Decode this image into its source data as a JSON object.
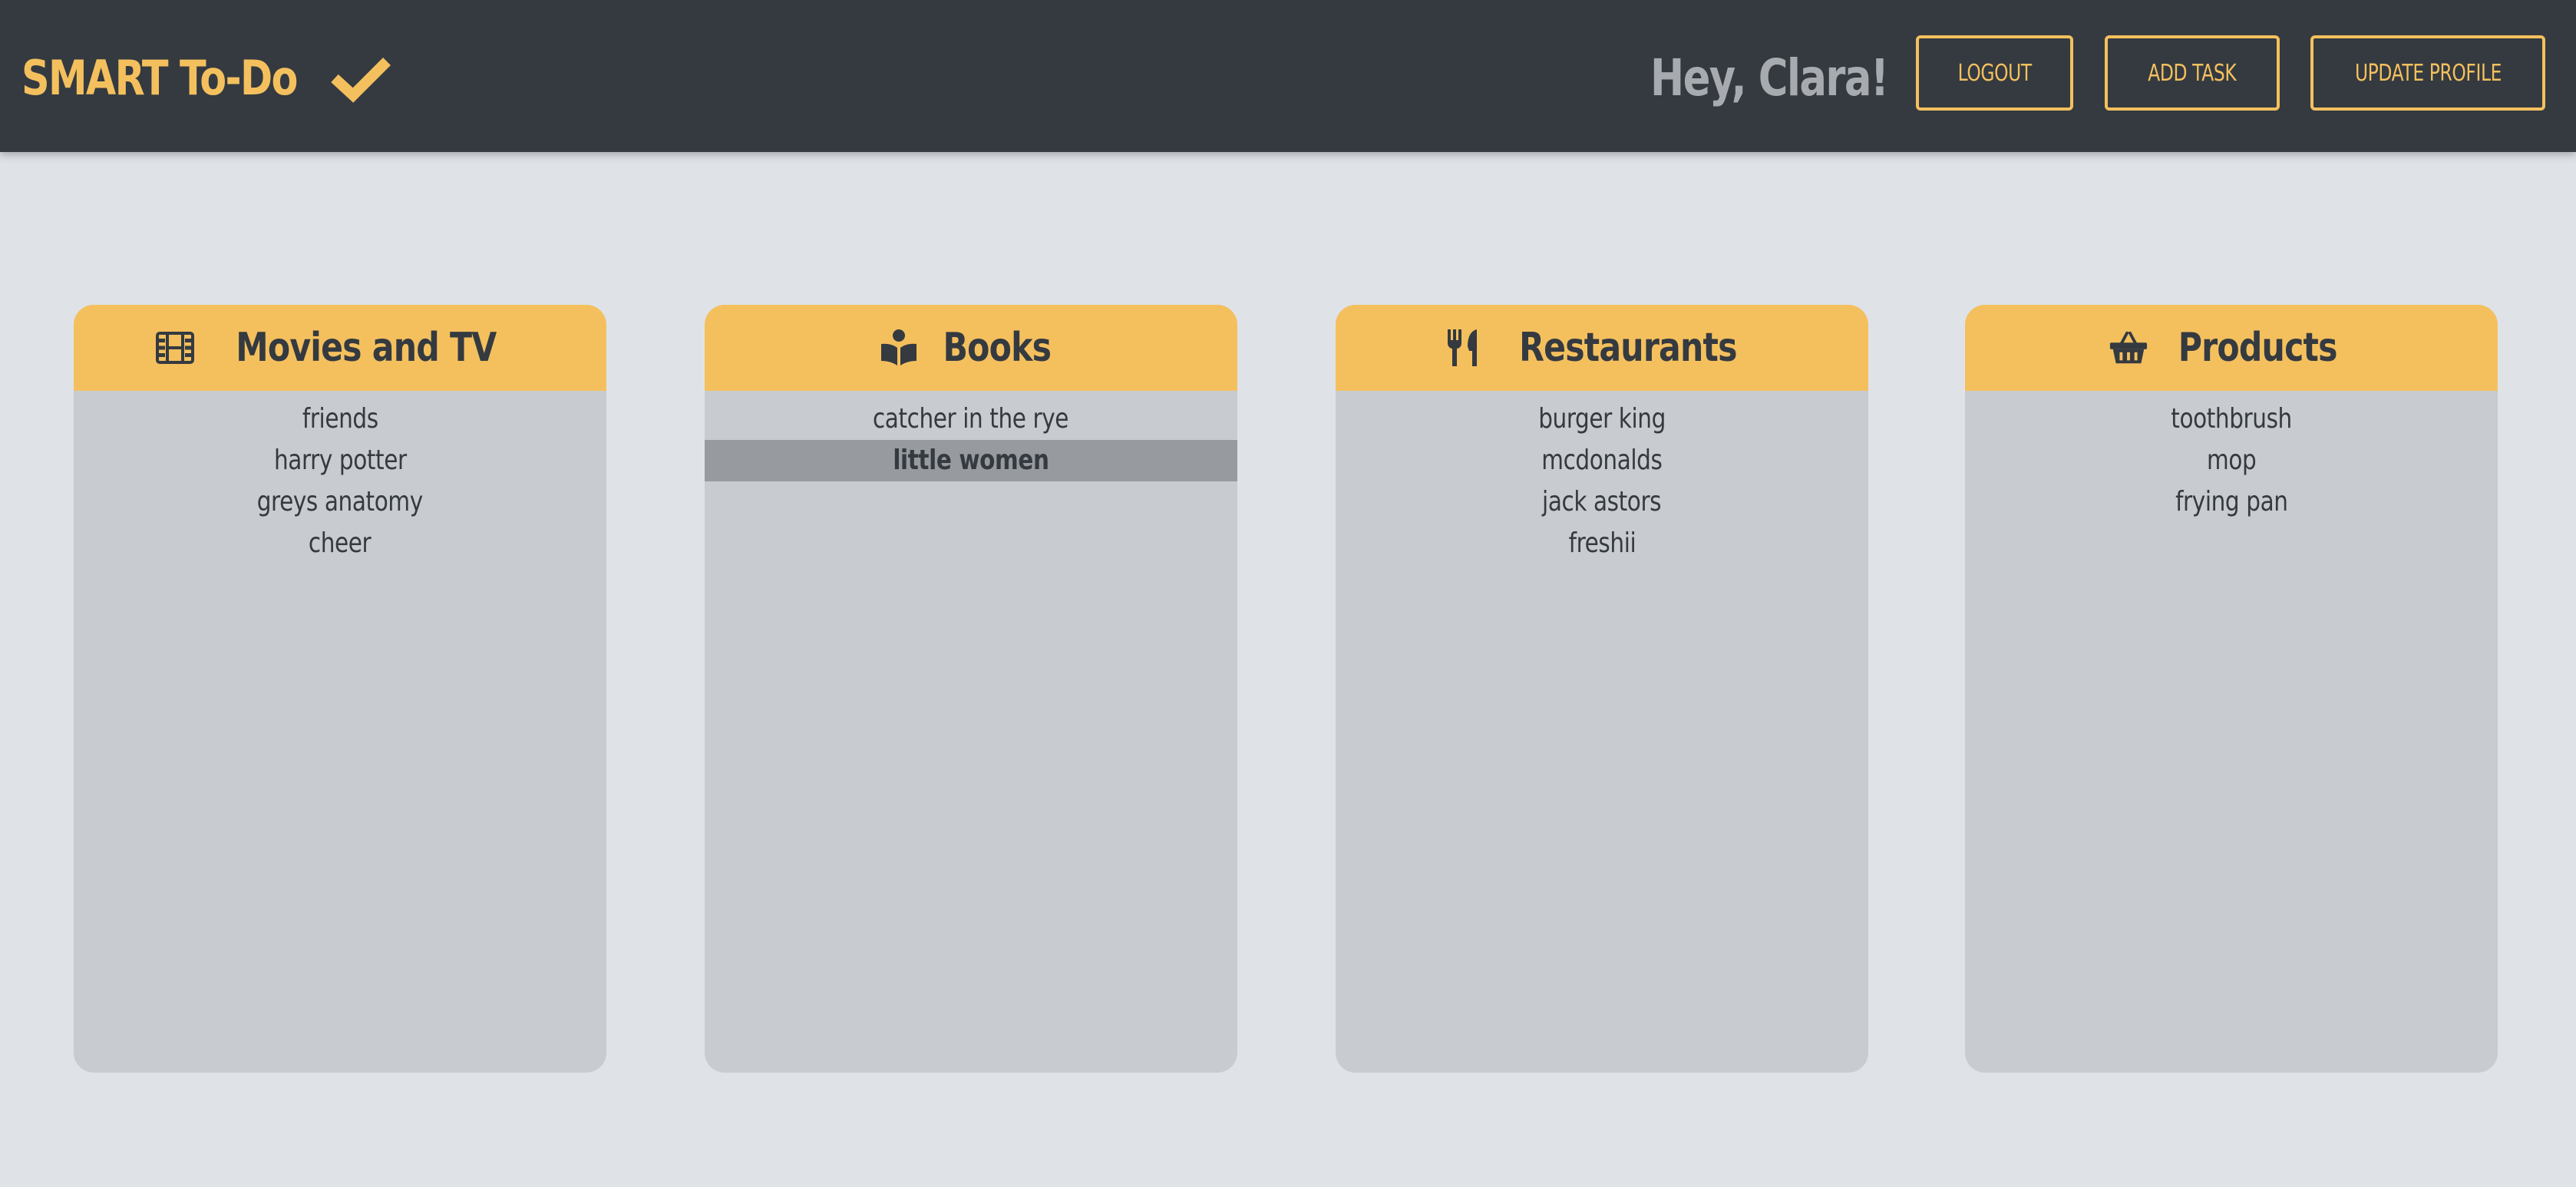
{
  "app": {
    "brand": "SMART To-Do",
    "brand_icon": "check-icon",
    "greeting": "Hey, Clara!"
  },
  "nav": {
    "logout_label": "LOGOUT",
    "add_task_label": "ADD TASK",
    "update_profile_label": "UPDATE PROFILE"
  },
  "colors": {
    "header_bg": "#343a40",
    "accent": "#f4c05e",
    "page_bg": "#dfe3e8",
    "card_bg": "#c8cbcf",
    "selected_row": "#979b9f",
    "text_dark": "#343a40",
    "greeting_text": "#a7abb0"
  },
  "categories": [
    {
      "title": "Movies and TV",
      "icon": "film-icon",
      "items": [
        "friends",
        "harry potter",
        "greys anatomy",
        "cheer"
      ]
    },
    {
      "title": "Books",
      "icon": "book-reader-icon",
      "items": [
        "catcher in the rye",
        "little women"
      ],
      "selected_item": "little women"
    },
    {
      "title": "Restaurants",
      "icon": "utensils-icon",
      "items": [
        "burger king",
        "mcdonalds",
        "jack astors",
        "freshii"
      ]
    },
    {
      "title": "Products",
      "icon": "shopping-basket-icon",
      "items": [
        "toothbrush",
        "mop",
        "frying pan"
      ]
    }
  ]
}
